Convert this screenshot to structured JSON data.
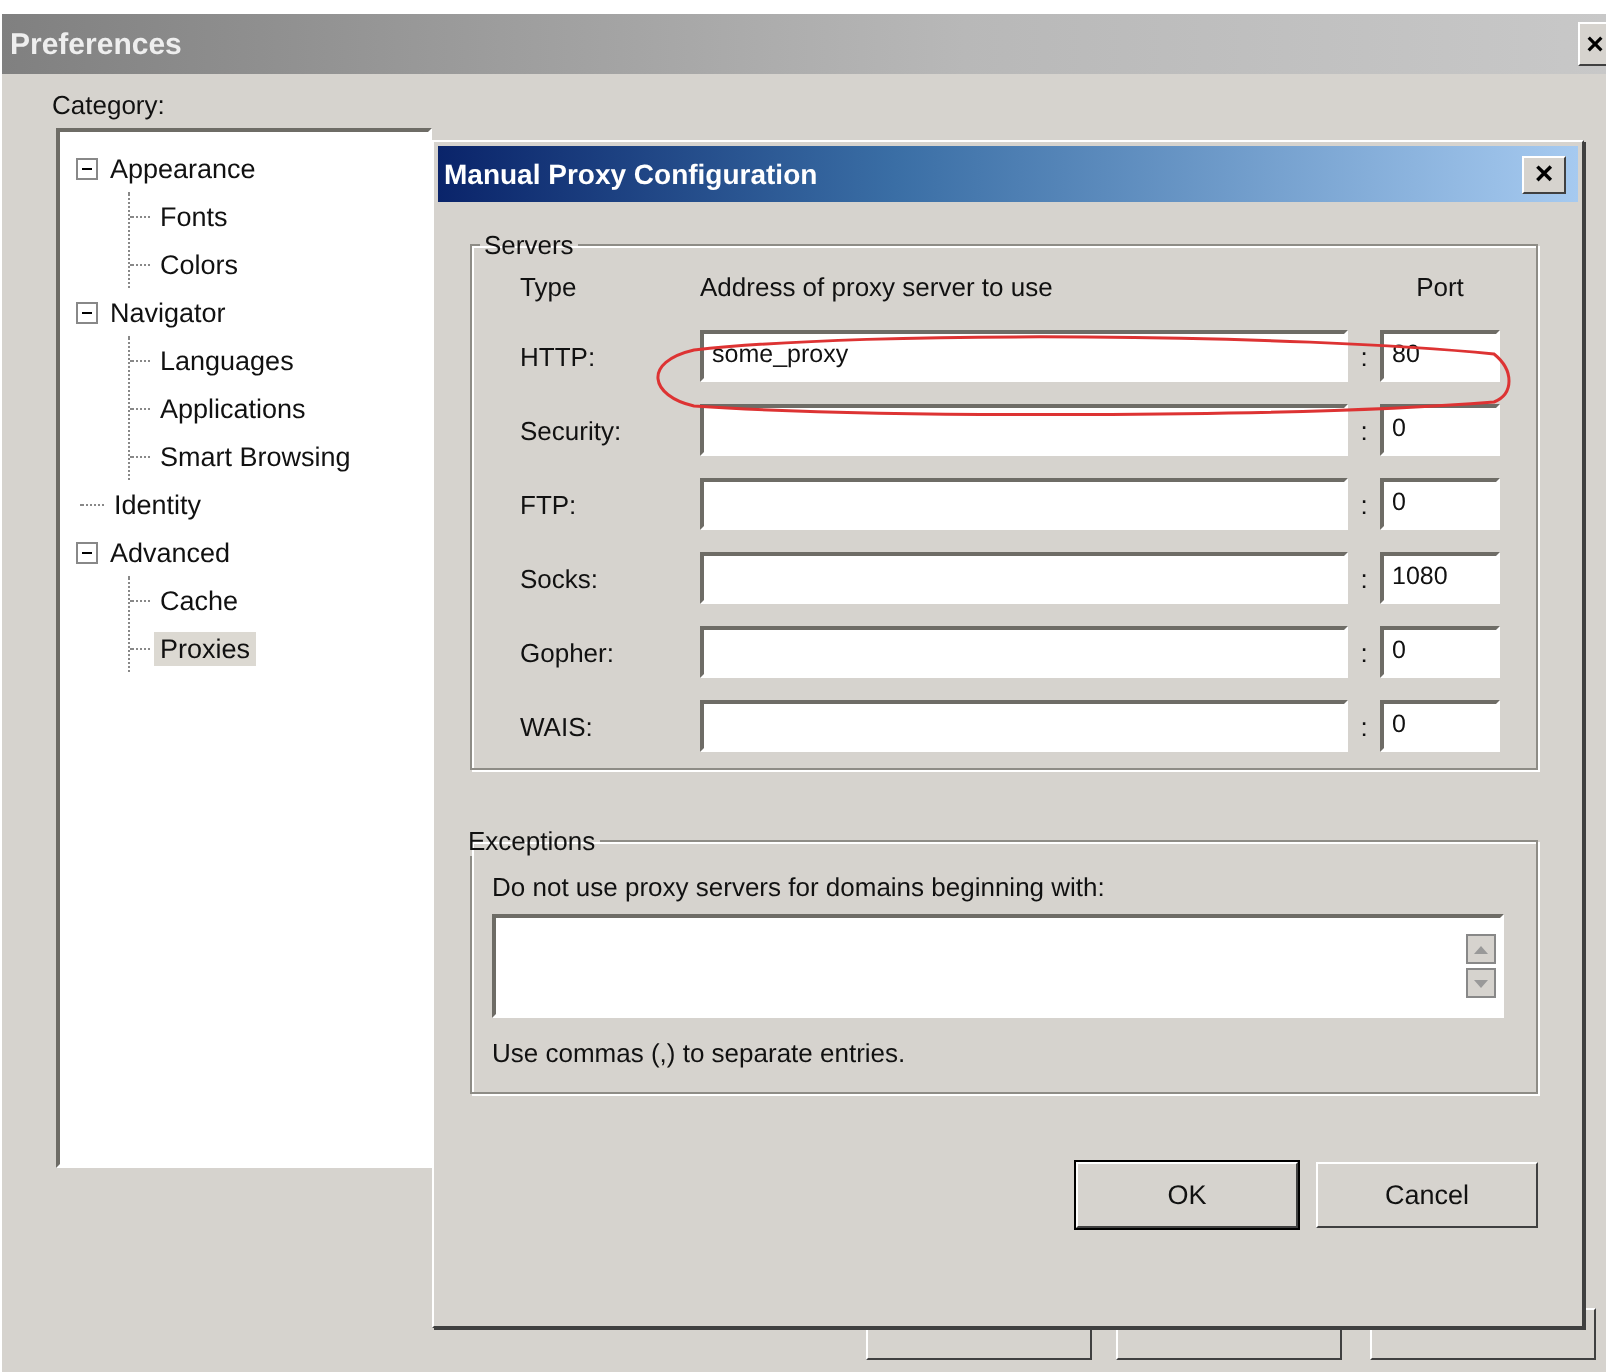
{
  "window": {
    "title": "Preferences",
    "close": "×"
  },
  "category_label": "Category:",
  "tree": [
    {
      "label": "Appearance",
      "expanded": true,
      "selected": false,
      "children": [
        {
          "label": "Fonts",
          "selected": false
        },
        {
          "label": "Colors",
          "selected": false
        }
      ]
    },
    {
      "label": "Navigator",
      "expanded": true,
      "selected": false,
      "children": [
        {
          "label": "Languages",
          "selected": false
        },
        {
          "label": "Applications",
          "selected": false
        },
        {
          "label": "Smart Browsing",
          "selected": false
        }
      ]
    },
    {
      "label": "Identity",
      "selected": false
    },
    {
      "label": "Advanced",
      "expanded": true,
      "selected": false,
      "children": [
        {
          "label": "Cache",
          "selected": false
        },
        {
          "label": "Proxies",
          "selected": true
        }
      ]
    }
  ],
  "dialog": {
    "title": "Manual Proxy Configuration",
    "close": "×",
    "servers": {
      "title": "Servers",
      "columns": [
        "Type",
        "Address of proxy server to use",
        "Port"
      ],
      "separator": ":",
      "rows": [
        {
          "type": "HTTP:",
          "address": "some_proxy",
          "port": "80",
          "highlighted": true
        },
        {
          "type": "Security:",
          "port": "0",
          "highlighted": false
        },
        {
          "type": "FTP:",
          "port": "0",
          "highlighted": false
        },
        {
          "type": "Socks:",
          "port": "1080",
          "highlighted": false
        },
        {
          "type": "Gopher:",
          "port": "0",
          "highlighted": false
        },
        {
          "type": "WAIS:",
          "port": "0",
          "highlighted": false
        }
      ]
    },
    "exceptions": {
      "title": "Exceptions",
      "label": "Do not use proxy servers for domains beginning with:",
      "hint": "Use commas (,) to separate entries."
    },
    "buttons": [
      {
        "label": "OK",
        "default": true
      },
      {
        "label": "Cancel",
        "default": false
      }
    ]
  }
}
